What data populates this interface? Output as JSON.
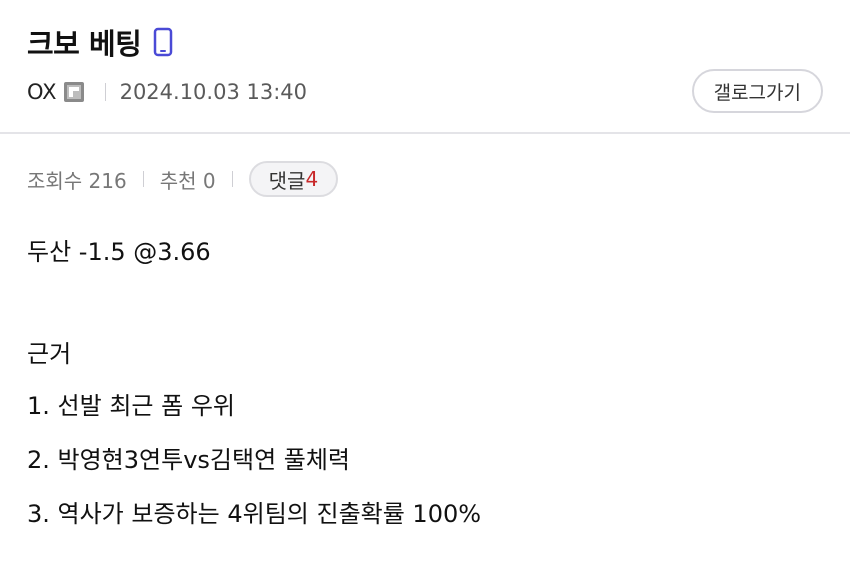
{
  "post": {
    "title": "크보 베팅",
    "author": "OX",
    "date": "2024.10.03 13:40",
    "gallery_button": "갤로그가기"
  },
  "stats": {
    "views_label": "조회수 216",
    "recommend_label": "추천 0",
    "comments_label": "댓글",
    "comments_count": "4"
  },
  "body": {
    "lines": [
      "두산 -1.5 @3.66",
      "근거",
      "1. 선발 최근 폼 우위",
      "2. 박영현3연투vs김택연 풀체력",
      "3. 역사가 보증하는 4위팀의 진출확률 100%"
    ]
  },
  "icons": {
    "title_icon": "mobile-phone-icon",
    "author_icon": "fixed-nickname-icon"
  },
  "colors": {
    "accent_comment_count": "#c8282a",
    "mobile_icon": "#4a4ad6"
  }
}
